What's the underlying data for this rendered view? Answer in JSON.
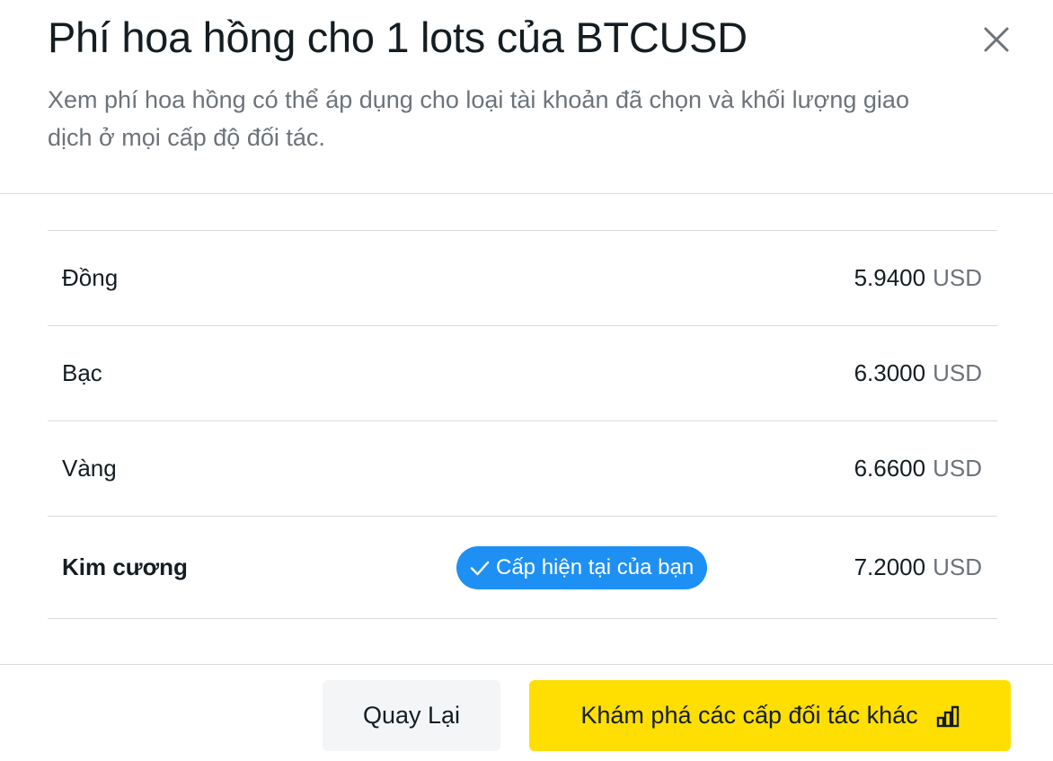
{
  "dialog": {
    "title": "Phí hoa hồng cho 1 lots của BTCUSD",
    "subtitle": "Xem phí hoa hồng có thể áp dụng cho loại tài khoản đã chọn và khối lượng giao dịch ở mọi cấp độ đối tác.",
    "close_icon": "close-icon"
  },
  "tiers": [
    {
      "name": "Đồng",
      "amount": "5.9400",
      "currency": "USD",
      "current": false
    },
    {
      "name": "Bạc",
      "amount": "6.3000",
      "currency": "USD",
      "current": false
    },
    {
      "name": "Vàng",
      "amount": "6.6600",
      "currency": "USD",
      "current": false
    },
    {
      "name": "Kim cương",
      "amount": "7.2000",
      "currency": "USD",
      "current": true
    }
  ],
  "current_badge": {
    "label": "Cấp hiện tại của bạn",
    "icon": "checkmark-icon",
    "color": "#1e90f4"
  },
  "footer": {
    "back_label": "Quay Lại",
    "explore_label": "Khám phá các cấp đối tác khác",
    "explore_icon": "bar-chart-icon",
    "explore_color": "#ffde02"
  }
}
